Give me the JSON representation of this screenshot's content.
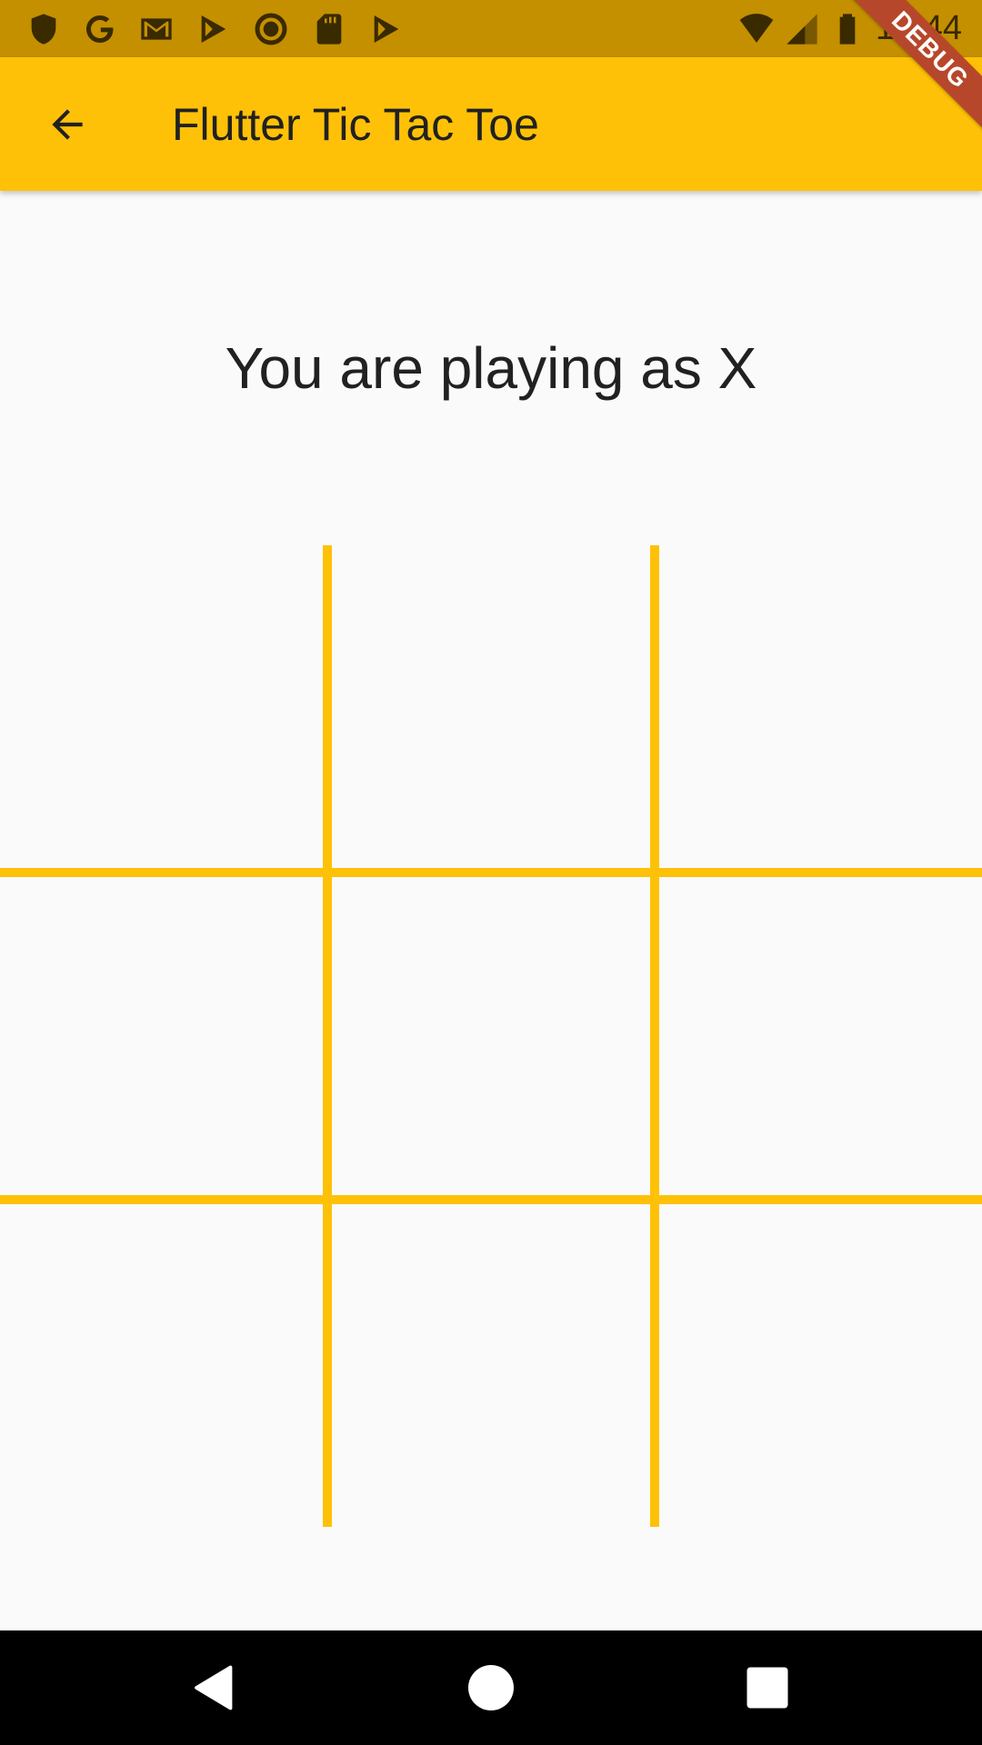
{
  "status_bar": {
    "time": "12:44",
    "left_icons": [
      "shield-icon",
      "google-icon",
      "gmail-icon",
      "play-store-icon",
      "circle-record-icon",
      "sd-card-icon",
      "play-store-icon"
    ],
    "right_icons": [
      "wifi-icon",
      "signal-icon",
      "battery-icon"
    ]
  },
  "app_bar": {
    "title": "Flutter Tic Tac Toe",
    "back_icon": "arrow-back-icon"
  },
  "debug_banner": "DEBUG",
  "main": {
    "player_text": "You are playing as X"
  },
  "board": {
    "cells": [
      "",
      "",
      "",
      "",
      "",
      "",
      "",
      "",
      ""
    ],
    "line_color": "#FFC107"
  },
  "nav_bar": {
    "buttons": [
      "back-triangle-icon",
      "home-circle-icon",
      "recents-square-icon"
    ]
  },
  "colors": {
    "accent": "#FFC107",
    "status_bar": "#C49000",
    "background": "#FAFAFA",
    "debug_ribbon": "#B7472A"
  }
}
